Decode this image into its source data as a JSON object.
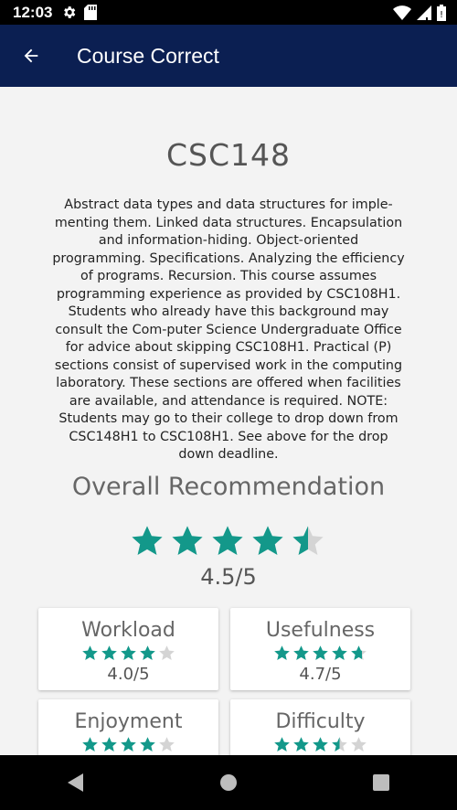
{
  "status_bar": {
    "time": "12:03",
    "left_icons": [
      "gear-icon",
      "sd-card-icon"
    ],
    "right_icons": [
      "wifi-icon",
      "cell-signal-icon",
      "battery-icon"
    ]
  },
  "app_bar": {
    "title": "Course Correct",
    "back_icon": "arrow-back-icon"
  },
  "course": {
    "code": "CSC148",
    "description": "Abstract data types and data structures for imple-menting them. Linked data structures. Encapsulation and information-hiding. Object-oriented programming. Specifications. Analyzing the efficiency of programs. Recursion. This course assumes programming experience as provided by CSC108H1. Students who already have this background may consult the Com-puter Science Undergraduate Office for advice about skipping CSC108H1. Practical (P) sections consist of supervised work in the computing laboratory. These sections are offered when facilities are available, and attendance is required. NOTE: Students may go to their college to drop down from CSC148H1 to CSC108H1. See above for the drop down deadline."
  },
  "overall": {
    "heading": "Overall Recommendation",
    "score_text": "4.5/5",
    "rating": 4.5
  },
  "metrics": [
    {
      "title": "Workload",
      "score_text": "4.0/5",
      "rating": 4.0
    },
    {
      "title": "Usefulness",
      "score_text": "4.7/5",
      "rating": 4.7
    },
    {
      "title": "Enjoyment",
      "score_text": "",
      "rating": 4.0
    },
    {
      "title": "Difficulty",
      "score_text": "",
      "rating": 3.5
    }
  ],
  "colors": {
    "app_bar": "#0b1f52",
    "star_filled": "#13988a",
    "star_empty": "#d4d4d4"
  },
  "nav_bar": {
    "icons": [
      "nav-back-icon",
      "nav-home-icon",
      "nav-recents-icon"
    ]
  }
}
